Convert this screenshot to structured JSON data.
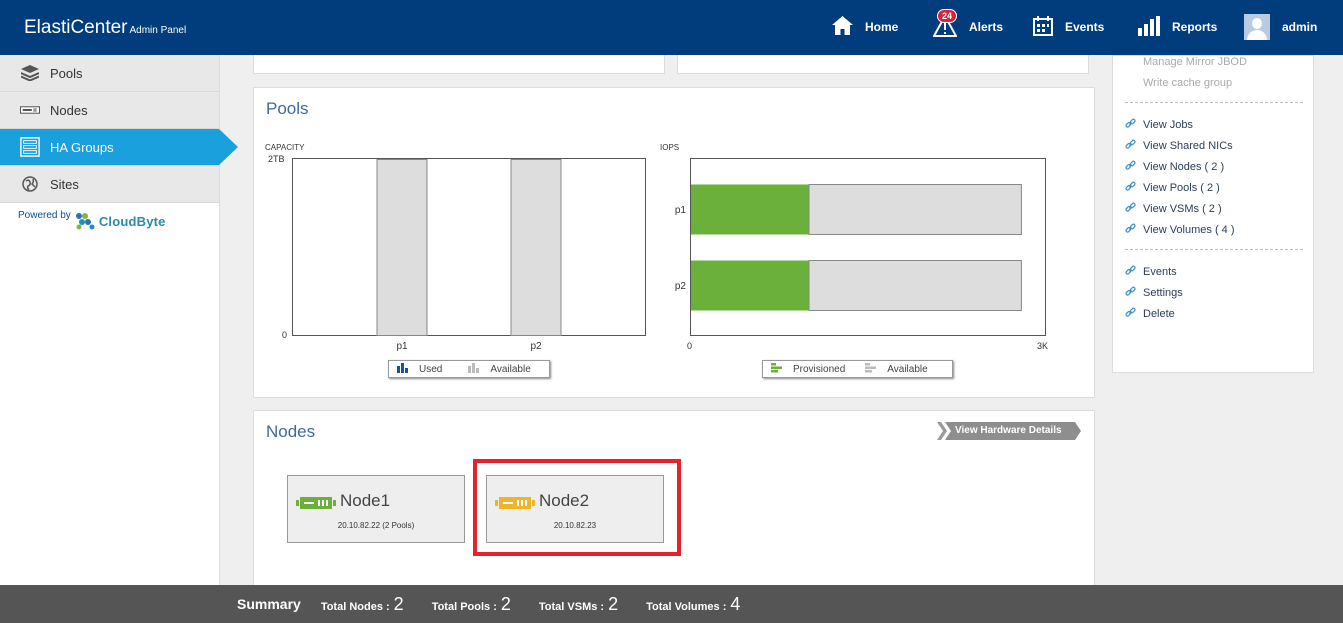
{
  "header": {
    "brand": "ElastiCenter",
    "brand_sub": "Admin Panel",
    "nav": [
      {
        "label": "Home",
        "icon": "home-icon"
      },
      {
        "label": "Alerts",
        "icon": "alert-icon",
        "badge": "24"
      },
      {
        "label": "Events",
        "icon": "calendar-icon"
      },
      {
        "label": "Reports",
        "icon": "bar-chart-icon"
      },
      {
        "label": "admin",
        "icon": "avatar"
      }
    ]
  },
  "sidebar": {
    "items": [
      {
        "label": "Pools",
        "icon": "layers-icon",
        "active": false
      },
      {
        "label": "Nodes",
        "icon": "server-icon",
        "active": false
      },
      {
        "label": "HA Groups",
        "icon": "ha-group-icon",
        "active": true
      },
      {
        "label": "Sites",
        "icon": "globe-icon",
        "active": false
      }
    ],
    "powered_by": "Powered by",
    "logo_text": "CloudByte"
  },
  "pools": {
    "title": "Pools",
    "capacity_chart": {
      "axis_title": "CAPACITY",
      "y_top": "2TB",
      "y_bottom": "0",
      "legend": [
        "Used",
        "Available"
      ]
    },
    "iops_chart": {
      "axis_title": "IOPS",
      "x_left": "0",
      "x_right": "3K",
      "legend": [
        "Provisioned",
        "Available"
      ]
    }
  },
  "chart_data": [
    {
      "type": "bar",
      "title": "CAPACITY",
      "categories": [
        "p1",
        "p2"
      ],
      "series": [
        {
          "name": "Used",
          "values": [
            0,
            0
          ]
        },
        {
          "name": "Available",
          "values": [
            2,
            2
          ]
        }
      ],
      "ylim": [
        0,
        2
      ],
      "yunit": "TB",
      "colors": {
        "Used": "#1f4ea0",
        "Available": "#dddddd"
      }
    },
    {
      "type": "bar",
      "orientation": "horizontal",
      "title": "IOPS",
      "categories": [
        "p1",
        "p2"
      ],
      "series": [
        {
          "name": "Provisioned",
          "values": [
            1000,
            1000
          ]
        },
        {
          "name": "Available",
          "values": [
            1800,
            1800
          ]
        }
      ],
      "xlim": [
        0,
        3000
      ],
      "colors": {
        "Provisioned": "#6ab03a",
        "Available": "#dddddd"
      }
    }
  ],
  "nodes": {
    "title": "Nodes",
    "view_hw_label": "View Hardware Details",
    "cards": [
      {
        "name": "Node1",
        "ip": "20.10.82.22 (2 Pools)",
        "status_color": "#6ab03a"
      },
      {
        "name": "Node2",
        "ip": "20.10.82.23",
        "status_color": "#f0b428"
      }
    ]
  },
  "actions": {
    "disabled": [
      "Manage Mirror JBOD",
      "Write cache group"
    ],
    "group1": [
      "View Jobs",
      "View Shared NICs",
      "View Nodes ( 2 )",
      "View Pools ( 2 )",
      "View VSMs ( 2 )",
      "View Volumes ( 4 )"
    ],
    "group2": [
      "Events",
      "Settings",
      "Delete"
    ]
  },
  "footer": {
    "summary": "Summary",
    "stats": [
      {
        "label": "Total Nodes :",
        "value": "2"
      },
      {
        "label": "Total Pools :",
        "value": "2"
      },
      {
        "label": "Total VSMs :",
        "value": "2"
      },
      {
        "label": "Total Volumes :",
        "value": "4"
      }
    ]
  }
}
